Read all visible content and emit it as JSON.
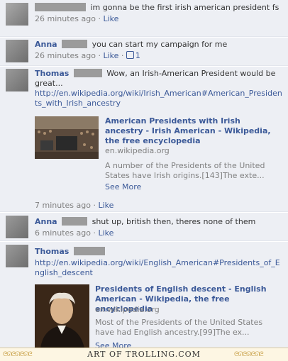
{
  "comments": [
    {
      "name": "",
      "text": "im gonna be the first irish american president fs",
      "time": "26 minutes ago",
      "like": "Like"
    },
    {
      "name": "Anna",
      "text": "you can start my campaign for me",
      "time": "26 minutes ago",
      "like": "Like",
      "likes_count": "1"
    },
    {
      "name": "Thomas",
      "text": "Wow, an Irish-American President would be great...",
      "link": "http://en.wikipedia.org/wiki/Irish_American#American_Presidents_with_Irish_ancestry",
      "attachment": {
        "title": "American Presidents with Irish ancestry - Irish American - Wikipedia, the free encyclopedia",
        "domain": "en.wikipedia.org",
        "desc": "A number of the Presidents of the United States have Irish origins.[143]The exte...",
        "more": "See More"
      },
      "time": "7 minutes ago",
      "like": "Like"
    },
    {
      "name": "Anna",
      "text": "shut up, british then, theres none of them",
      "time": "6 minutes ago",
      "like": "Like"
    },
    {
      "name": "Thomas",
      "text": "",
      "link": "http://en.wikipedia.org/wiki/English_American#Presidents_of_English_descent",
      "attachment": {
        "title": "Presidents of English descent - English American - Wikipedia, the free encyclopedia",
        "domain": "en.wikipedia.org",
        "desc": "Most of the Presidents of the United States have had English ancestry.[99]The ex...",
        "more": "See More"
      }
    }
  ],
  "footer": {
    "text": "ART OF TROLLING.COM"
  },
  "colors": {
    "link": "#3b5998",
    "bg": "#edeff4",
    "meta": "#808080"
  }
}
